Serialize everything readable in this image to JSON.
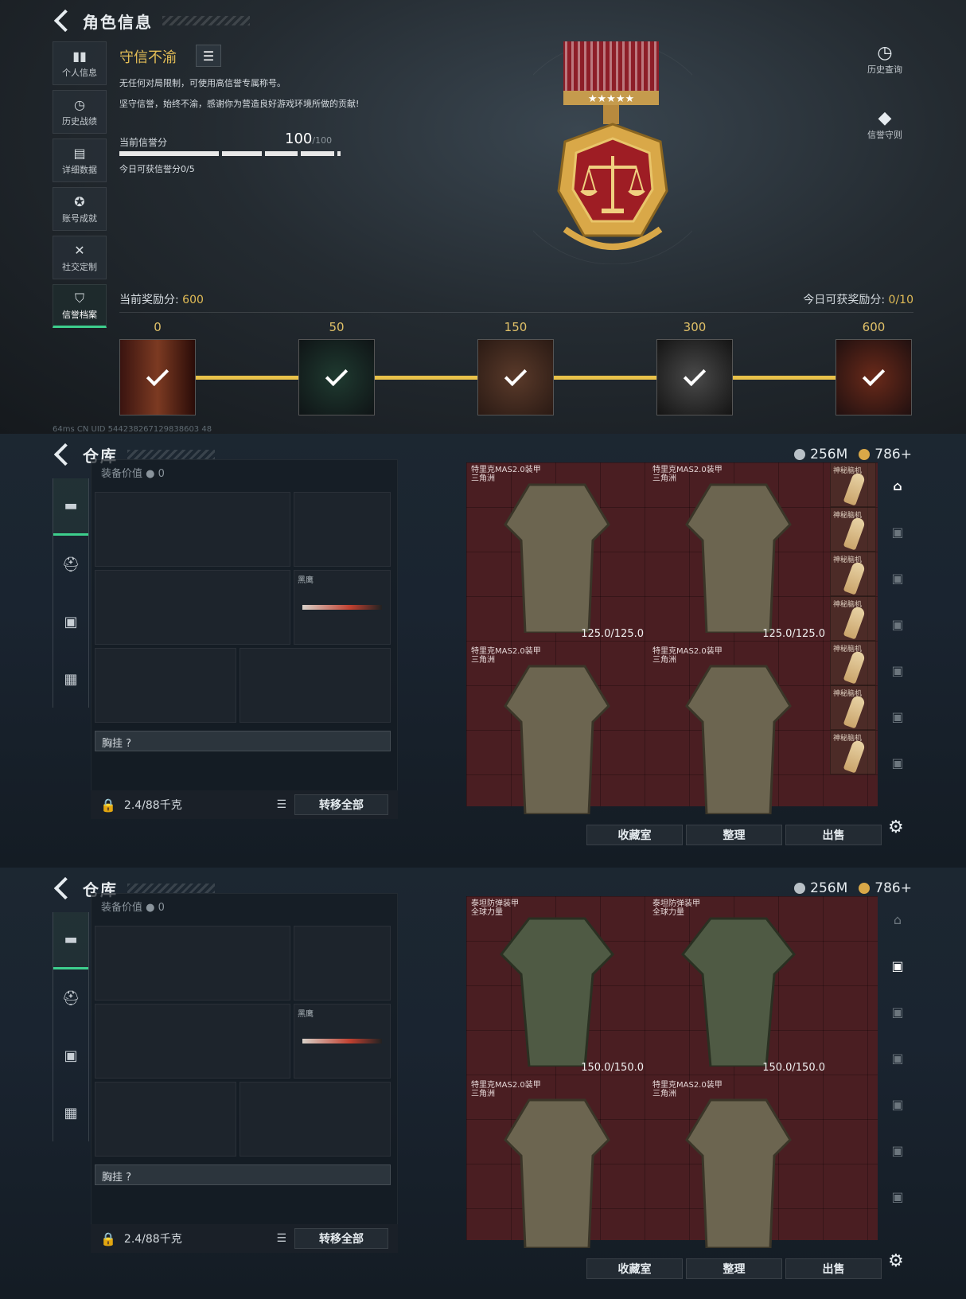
{
  "profile": {
    "header_title": "角色信息",
    "nav": [
      "个人信息",
      "历史战绩",
      "详细数据",
      "账号成就",
      "社交定制",
      "信誉档案"
    ],
    "nav_icons": [
      "bar-chart-icon",
      "history-icon",
      "data-icon",
      "achievement-icon",
      "tools-icon",
      "shield-icon"
    ],
    "title": "守信不渝",
    "desc1": "无任何对局限制，可使用高信誉专属称号。",
    "desc2": "坚守信誉，始终不渝，感谢你为营造良好游戏环境所做的贡献!",
    "score_label": "当前信誉分",
    "score": "100",
    "score_max": "/100",
    "today_score": "今日可获信誉分0/5",
    "reward_label": "当前奖励分:",
    "reward_value": "600",
    "today_reward_label": "今日可获奖励分:",
    "today_reward_value": "0/10",
    "milestones": [
      "0",
      "50",
      "150",
      "300",
      "600"
    ],
    "right_actions": [
      "历史查询",
      "信誉守则"
    ],
    "footer": "64ms   CN UID 544238267129838603 48"
  },
  "storage1": {
    "header_title": "仓库",
    "currency1": "256M",
    "currency2": "786+",
    "equip_value_label": "装备价值",
    "equip_value": "0",
    "melee_label": "黑鹰",
    "chest_label": "胸挂 ?",
    "weight": "2.4/88千克",
    "transfer_all": "转移全部",
    "cells": [
      {
        "name1": "特里克MAS2.0装甲",
        "name2": "三角洲",
        "dur": "125.0/125.0"
      },
      {
        "name1": "特里克MAS2.0装甲",
        "name2": "三角洲",
        "dur": "125.0/125.0"
      },
      {
        "name1": "特里克MAS2.0装甲",
        "name2": "三角洲",
        "dur": ""
      },
      {
        "name1": "特里克MAS2.0装甲",
        "name2": "三角洲",
        "dur": ""
      }
    ],
    "mini_label": "神秘脑机",
    "buttons": [
      "收藏室",
      "整理",
      "出售"
    ]
  },
  "storage2": {
    "header_title": "仓库",
    "currency1": "256M",
    "currency2": "786+",
    "equip_value_label": "装备价值",
    "equip_value": "0",
    "melee_label": "黑鹰",
    "chest_label": "胸挂 ?",
    "weight": "2.4/88千克",
    "transfer_all": "转移全部",
    "cells": [
      {
        "name1": "泰坦防弹装甲",
        "name2": "全球力量",
        "dur": "150.0/150.0"
      },
      {
        "name1": "泰坦防弹装甲",
        "name2": "全球力量",
        "dur": "150.0/150.0"
      },
      {
        "name1": "特里克MAS2.0装甲",
        "name2": "三角洲",
        "dur": ""
      },
      {
        "name1": "特里克MAS2.0装甲",
        "name2": "三角洲",
        "dur": ""
      }
    ],
    "buttons": [
      "收藏室",
      "整理",
      "出售"
    ]
  },
  "colors": {
    "accent_green": "#3dcf8d",
    "gold": "#e3bd56",
    "grid_red": "#4a1e22"
  }
}
